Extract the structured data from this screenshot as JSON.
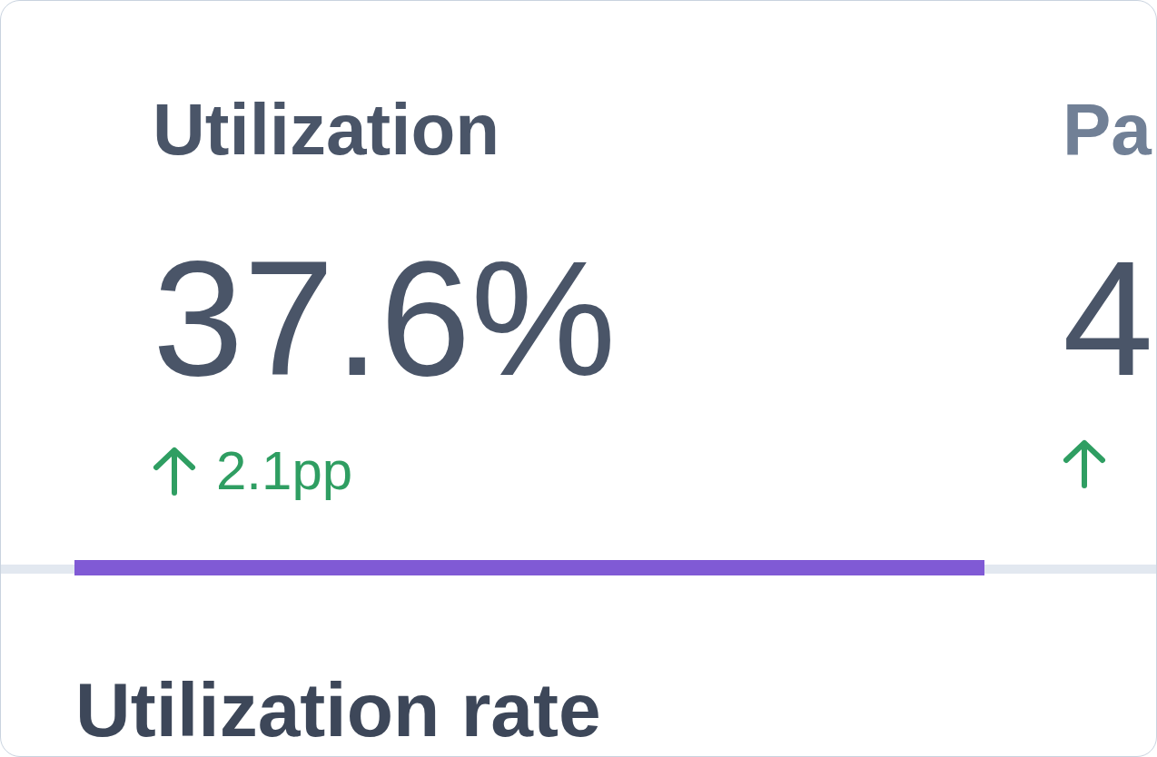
{
  "tabs": [
    {
      "label": "Utilization",
      "value": "37.6%",
      "change": {
        "positive": true,
        "text": "2.1pp"
      },
      "selected": true
    },
    {
      "label": "Pa",
      "value": "4",
      "change": {
        "positive": true
      },
      "selected": false
    }
  ],
  "section": {
    "title": "Utilization rate"
  }
}
